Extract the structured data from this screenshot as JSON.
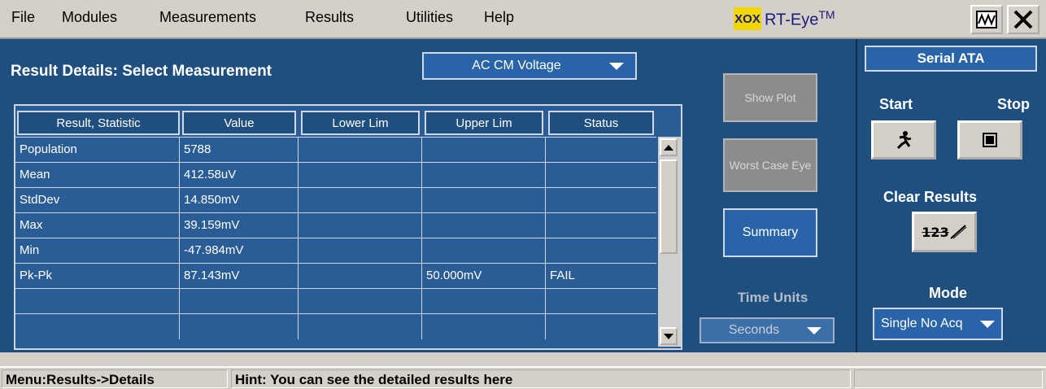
{
  "menu": [
    "File",
    "Modules",
    "Measurements",
    "Results",
    "Utilities",
    "Help"
  ],
  "brand": {
    "logo": "XOX",
    "name": "RT-Eye",
    "tm": "TM"
  },
  "window_icons": [
    "waveform-window-icon",
    "close-icon"
  ],
  "main": {
    "title": "Result Details: Select Measurement",
    "measurement_select": "AC CM Voltage",
    "table": {
      "headers": [
        "Result, Statistic",
        "Value",
        "Lower Lim",
        "Upper Lim",
        "Status"
      ],
      "rows": [
        [
          "Population",
          "5788",
          "",
          "",
          ""
        ],
        [
          "Mean",
          "412.58uV",
          "",
          "",
          ""
        ],
        [
          "StdDev",
          "14.850mV",
          "",
          "",
          ""
        ],
        [
          "Max",
          "39.159mV",
          "",
          "",
          ""
        ],
        [
          "Min",
          "-47.984mV",
          "",
          "",
          ""
        ],
        [
          "Pk-Pk",
          "87.143mV",
          "",
          "50.000mV",
          "FAIL"
        ],
        [
          "",
          "",
          "",
          "",
          ""
        ],
        [
          "",
          "",
          "",
          "",
          ""
        ]
      ]
    },
    "buttons": {
      "show_plot": "Show Plot",
      "worst_case_eye": "Worst Case Eye",
      "summary": "Summary"
    },
    "time_units": {
      "label": "Time Units",
      "value": "Seconds"
    }
  },
  "side": {
    "standard": "Serial ATA",
    "start_label": "Start",
    "stop_label": "Stop",
    "clear_results_label": "Clear Results",
    "clear_icon_text": "123",
    "mode_label": "Mode",
    "mode_value": "Single No Acq"
  },
  "status": {
    "menu_path": "Menu:Results->Details",
    "hint": "Hint: You can see the detailed results here"
  },
  "colors": {
    "panel": "#1f4f7e",
    "cell": "#2a5d96",
    "button": "#2a64a8",
    "chrome": "#d4d0c8"
  }
}
